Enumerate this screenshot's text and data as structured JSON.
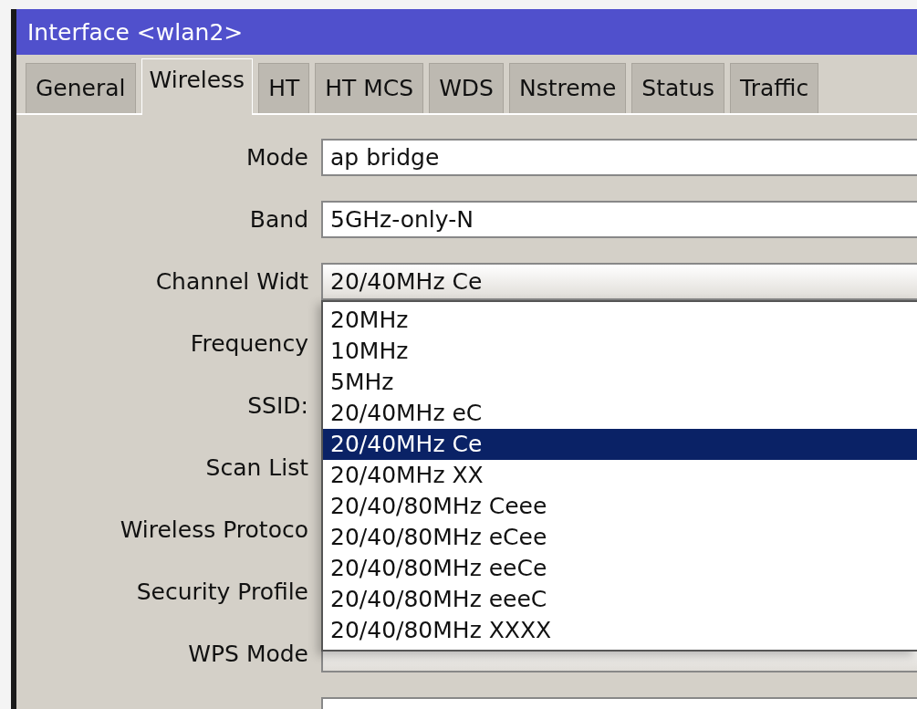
{
  "window": {
    "title": "Interface <wlan2>"
  },
  "tabs": [
    {
      "label": "General",
      "selected": false
    },
    {
      "label": "Wireless",
      "selected": true
    },
    {
      "label": "HT",
      "selected": false
    },
    {
      "label": "HT MCS",
      "selected": false
    },
    {
      "label": "WDS",
      "selected": false
    },
    {
      "label": "Nstreme",
      "selected": false
    },
    {
      "label": "Status",
      "selected": false
    },
    {
      "label": "Traffic",
      "selected": false
    }
  ],
  "fields": [
    {
      "label": "Mode",
      "kind": "text",
      "value": "ap bridge"
    },
    {
      "label": "Band",
      "kind": "text",
      "value": "5GHz-only-N"
    },
    {
      "label": "Channel Widt",
      "kind": "combo",
      "value": "20/40MHz Ce"
    },
    {
      "label": "Frequency",
      "kind": "covered"
    },
    {
      "label": "SSID:",
      "kind": "covered"
    },
    {
      "label": "Scan List",
      "kind": "covered"
    },
    {
      "label": "Wireless Protoco",
      "kind": "covered"
    },
    {
      "label": "Security Profile",
      "kind": "covered"
    },
    {
      "label": "WPS Mode",
      "kind": "combo"
    },
    {
      "kind": "text"
    }
  ],
  "dropdown": {
    "options": [
      {
        "label": "20MHz",
        "selected": false
      },
      {
        "label": "10MHz",
        "selected": false
      },
      {
        "label": "5MHz",
        "selected": false
      },
      {
        "label": "20/40MHz eC",
        "selected": false
      },
      {
        "label": "20/40MHz Ce",
        "selected": true
      },
      {
        "label": "20/40MHz XX",
        "selected": false
      },
      {
        "label": "20/40/80MHz Ceee",
        "selected": false
      },
      {
        "label": "20/40/80MHz eCee",
        "selected": false
      },
      {
        "label": "20/40/80MHz eeCe",
        "selected": false
      },
      {
        "label": "20/40/80MHz eeeC",
        "selected": false
      },
      {
        "label": "20/40/80MHz XXXX",
        "selected": false
      }
    ]
  }
}
